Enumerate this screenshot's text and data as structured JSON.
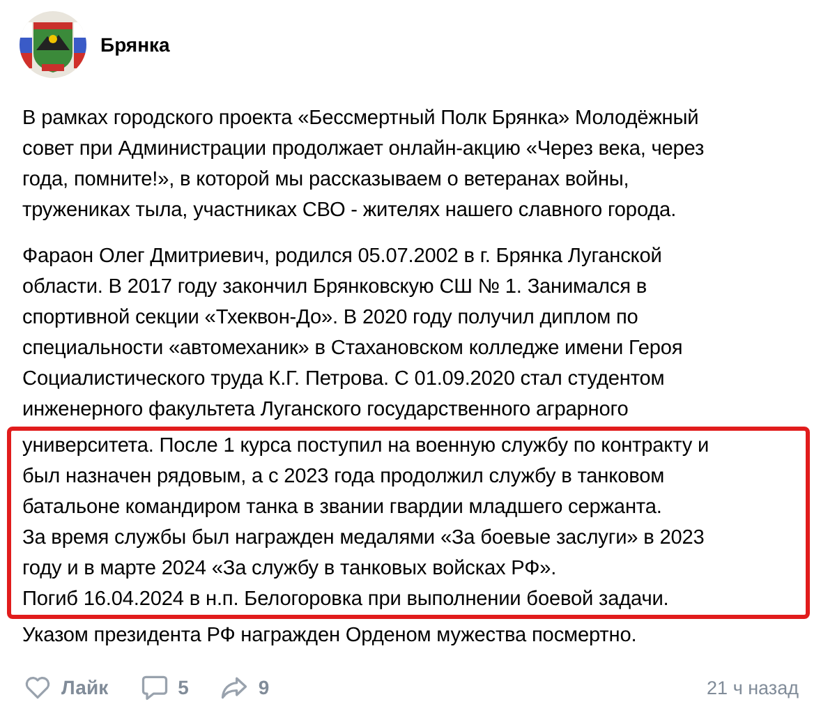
{
  "post": {
    "author": "Брянка",
    "paragraphs": [
      {
        "segments": [
          {
            "highlighted": false,
            "lines": [
              "В рамках городского проекта «Бессмертный Полк  Брянка» Молодёжный",
              "совет при Администрации продолжает онлайн-акцию «Через века, через",
              "года, помните!», в которой мы рассказываем о ветеранах войны,",
              "тружениках тыла, участниках СВО - жителях нашего славного города."
            ]
          }
        ]
      },
      {
        "segments": [
          {
            "highlighted": false,
            "lines": [
              "Фараон Олег Дмитриевич, родился 05.07.2002 в г. Брянка Луганской",
              "области. В 2017 году закончил Брянковскую СШ № 1. Занимался в",
              "спортивной секции «Тхеквон-До». В 2020 году получил диплом по",
              "специальности «автомеханик» в Стахановском колледже имени Героя",
              "Социалистического труда К.Г. Петрова. С 01.09.2020 стал студентом",
              "инженерного факультета Луганского государственного аграрного"
            ]
          },
          {
            "highlighted": true,
            "lines": [
              "университета. После 1 курса поступил на военную службу по контракту и",
              "был назначен рядовым, а с 2023 года продолжил службу в танковом",
              "батальоне командиром танка в звании гвардии младшего сержанта.",
              "За время службы был награжден медалями «За боевые заслуги» в 2023",
              "году и в марте 2024 «За службу в танковых войсках РФ».",
              "Погиб 16.04.2024 в н.п. Белогоровка при выполнении боевой задачи."
            ]
          },
          {
            "highlighted": false,
            "lines": [
              "Указом президента РФ награжден Орденом мужества посмертно."
            ]
          }
        ]
      }
    ],
    "like_label": "Лайк",
    "comment_count": "5",
    "share_count": "9",
    "time": "21 ч назад"
  }
}
